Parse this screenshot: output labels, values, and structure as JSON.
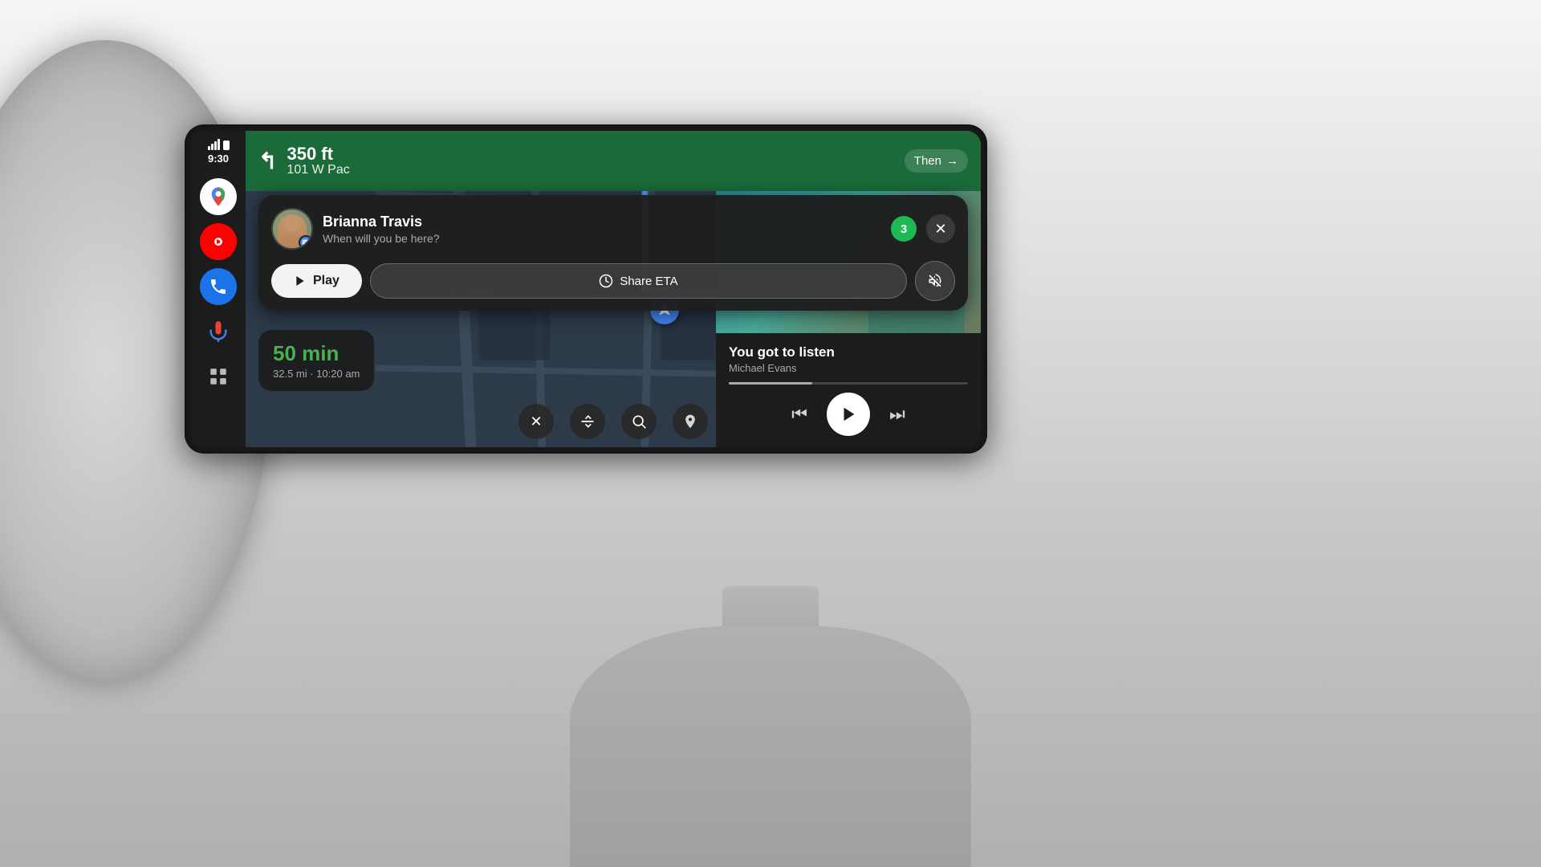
{
  "status_bar": {
    "time": "9:30",
    "signal_label": "signal"
  },
  "sidebar": {
    "icons": [
      {
        "name": "maps-icon",
        "label": "Google Maps"
      },
      {
        "name": "youtube-icon",
        "label": "YouTube Music"
      },
      {
        "name": "phone-icon",
        "label": "Phone"
      },
      {
        "name": "mic-icon",
        "label": "Microphone"
      },
      {
        "name": "grid-icon",
        "label": "App Grid"
      }
    ]
  },
  "navigation": {
    "distance": "350 ft",
    "street": "101 W Pac",
    "then_label": "Then",
    "eta_minutes": "50 min",
    "eta_detail": "32.5 mi · 10:20 am"
  },
  "notification": {
    "sender_name": "Brianna Travis",
    "subtitle": "When will you be here?",
    "count": "3",
    "play_label": "Play",
    "share_eta_label": "Share ETA",
    "mute_label": "Mute",
    "close_label": "Close"
  },
  "music": {
    "song_title": "You got to listen",
    "artist": "Michael Evans",
    "progress_percent": 35
  },
  "toolbar": {
    "close_label": "✕",
    "route_label": "⑂",
    "search_label": "⌕",
    "pin_label": "⊕"
  }
}
